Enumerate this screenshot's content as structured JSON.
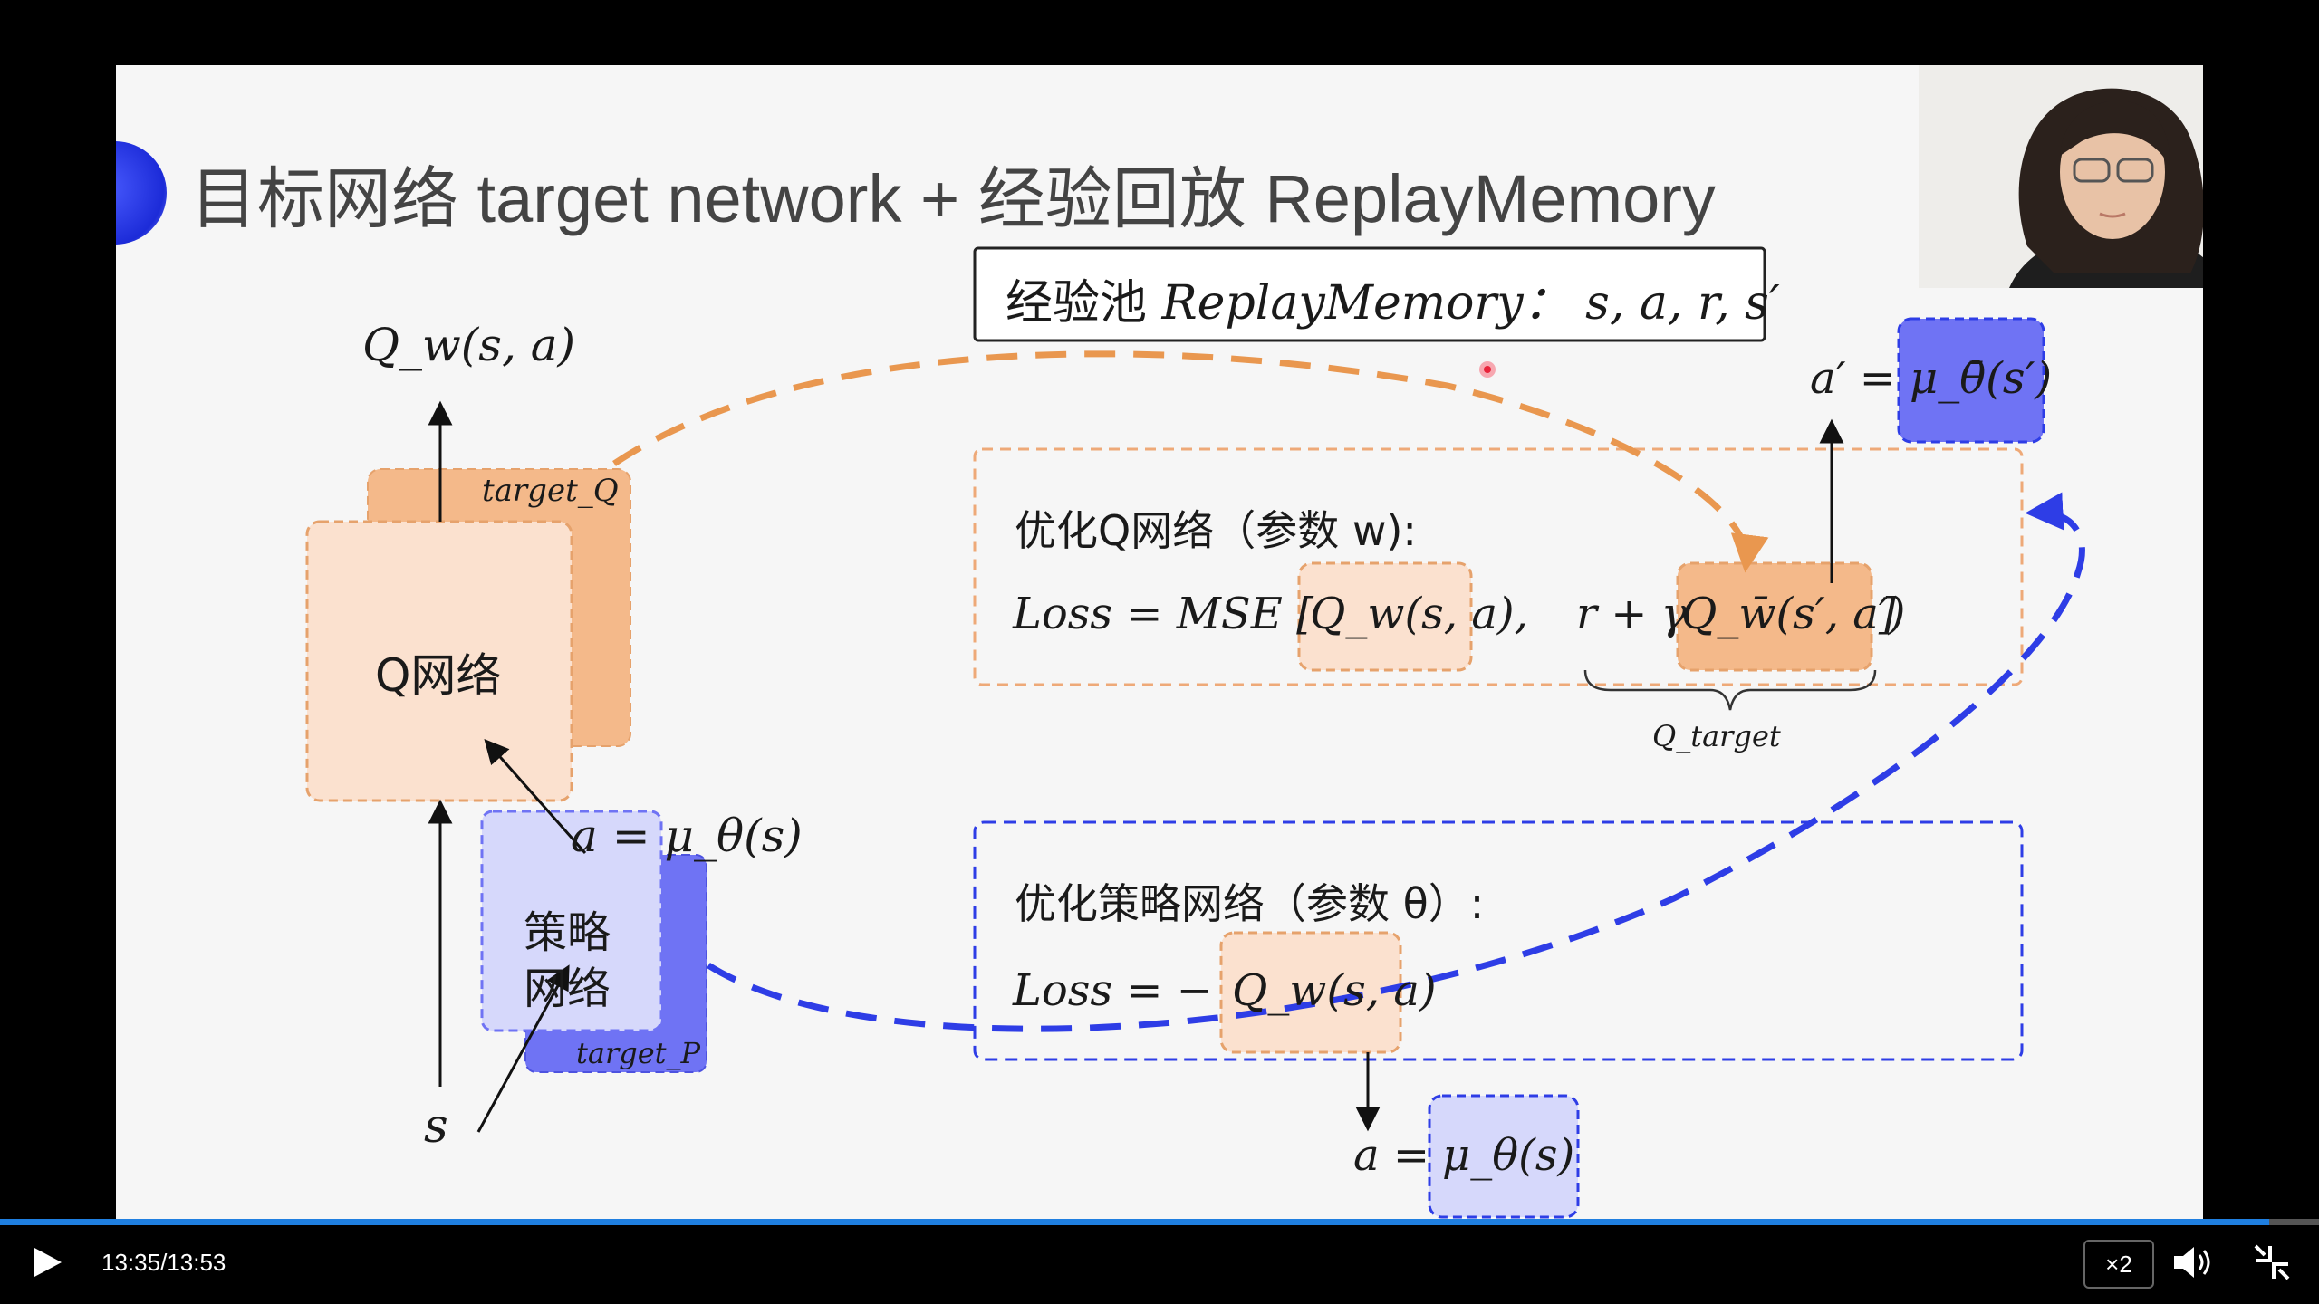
{
  "slide": {
    "title": "目标网络 target network + 经验回放 ReplayMemory",
    "replay_box": {
      "prefix": "经验池 ",
      "math": "ReplayMemory",
      "suffix": "： s, a, r, s′"
    },
    "q_side": {
      "output_label": "Q_w(s, a)",
      "target_label": "target_Q",
      "q_network_label": "Q网络",
      "action_label": "a = μ_θ(s)",
      "policy_label_line1": "策略",
      "policy_label_line2": "网络",
      "target_policy_label": "target_P",
      "state_label": "s"
    },
    "optimize_q": {
      "title": "优化Q网络（参数 w):",
      "loss_prefix": "Loss = MSE [",
      "q_term": "Q_w(s, a),",
      "target_term_prefix": "r + γ",
      "target_term": "Q_w̄(s′, a′)",
      "loss_suffix": "]",
      "brace_label": "Q_target"
    },
    "target_action": {
      "prefix": "a′ =",
      "term": "μ_θ̄(s′)"
    },
    "optimize_policy": {
      "title": "优化策略网络（参数 θ）:",
      "loss_prefix": "Loss = −",
      "q_term": "Q_w(s, a)"
    },
    "policy_output": {
      "prefix": "a =",
      "term": "μ_θ(s)"
    }
  },
  "player": {
    "time_current": "13:35",
    "time_separator": "/",
    "time_total": "13:53",
    "progress": 0.9784,
    "speed": "×2",
    "play_icon": "play-icon",
    "volume_icon": "volume-icon",
    "exit_fullscreen_icon": "exit-fullscreen-icon"
  },
  "colors": {
    "orange_fill": "#f4b98a",
    "orange_dash": "#e9974f",
    "peach_fill": "#fbe1cf",
    "lavender_fill": "#d6d8fb",
    "blue_fill": "#6f73f4",
    "blue_dash": "#2e3de6",
    "progress": "#1f7fe0"
  }
}
